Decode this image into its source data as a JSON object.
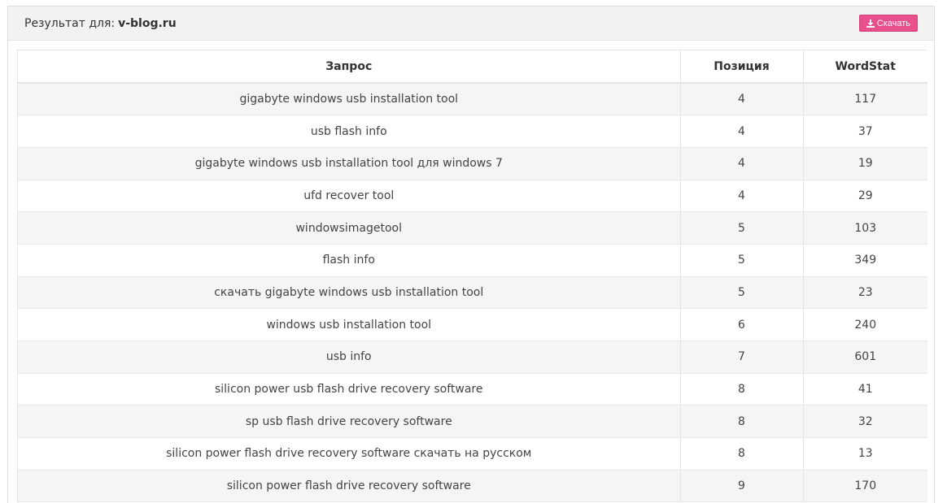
{
  "header": {
    "result_label": "Результат для:",
    "domain": "v-blog.ru",
    "download_label": "Скачать",
    "download_icon": "download-icon"
  },
  "table": {
    "columns": [
      "Запрос",
      "Позиция",
      "WordStat"
    ],
    "rows": [
      {
        "query": "gigabyte windows usb installation tool",
        "position": "4",
        "wordstat": "117"
      },
      {
        "query": "usb flash info",
        "position": "4",
        "wordstat": "37"
      },
      {
        "query": "gigabyte windows usb installation tool для windows 7",
        "position": "4",
        "wordstat": "19"
      },
      {
        "query": "ufd recover tool",
        "position": "4",
        "wordstat": "29"
      },
      {
        "query": "windowsimagetool",
        "position": "5",
        "wordstat": "103"
      },
      {
        "query": "flash info",
        "position": "5",
        "wordstat": "349"
      },
      {
        "query": "скачать gigabyte windows usb installation tool",
        "position": "5",
        "wordstat": "23"
      },
      {
        "query": "windows usb installation tool",
        "position": "6",
        "wordstat": "240"
      },
      {
        "query": "usb info",
        "position": "7",
        "wordstat": "601"
      },
      {
        "query": "silicon power usb flash drive recovery software",
        "position": "8",
        "wordstat": "41"
      },
      {
        "query": "sp usb flash drive recovery software",
        "position": "8",
        "wordstat": "32"
      },
      {
        "query": "silicon power flash drive recovery software скачать на русском",
        "position": "8",
        "wordstat": "13"
      },
      {
        "query": "silicon power flash drive recovery software",
        "position": "9",
        "wordstat": "170"
      }
    ]
  },
  "colors": {
    "accent": "#e84f8c",
    "heading_bg": "#f2f2f2",
    "stripe": "#f5f5f5"
  }
}
